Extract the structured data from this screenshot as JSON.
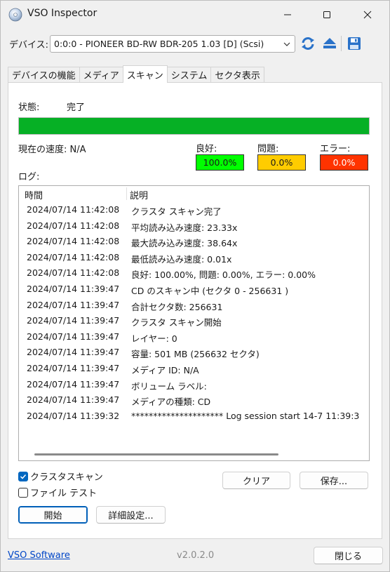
{
  "window": {
    "title": "VSO Inspector"
  },
  "device": {
    "label": "デバイス:",
    "selected": "0:0:0 - PIONEER BD-RW   BDR-205 1.03 [D] (Scsi)"
  },
  "tabs": [
    {
      "label": "デバイスの機能"
    },
    {
      "label": "メディア"
    },
    {
      "label": "スキャン"
    },
    {
      "label": "システム"
    },
    {
      "label": "セクタ表示"
    }
  ],
  "scan": {
    "status_label": "状態:",
    "status_value": "完了",
    "progress": 1.0,
    "speed_label": "現在の速度: N/A",
    "good_label": "良好:",
    "good_value": "100.0%",
    "problem_label": "問題:",
    "problem_value": "0.0%",
    "error_label": "エラー:",
    "error_value": "0.0%",
    "log_label": "ログ:",
    "log_header_time": "時間",
    "log_header_desc": "説明",
    "log": [
      {
        "time": "2024/07/14 11:42:08",
        "desc": "クラスタ スキャン完了"
      },
      {
        "time": "2024/07/14 11:42:08",
        "desc": "平均読み込み速度: 23.33x"
      },
      {
        "time": "2024/07/14 11:42:08",
        "desc": "最大読み込み速度: 38.64x"
      },
      {
        "time": "2024/07/14 11:42:08",
        "desc": "最低読み込み速度: 0.01x"
      },
      {
        "time": "2024/07/14 11:42:08",
        "desc": "良好: 100.00%, 問題: 0.00%, エラー: 0.00%"
      },
      {
        "time": "2024/07/14 11:39:47",
        "desc": "CD のスキャン中 (セクタ 0 - 256631 )"
      },
      {
        "time": "2024/07/14 11:39:47",
        "desc": "合計セクタ数: 256631"
      },
      {
        "time": "2024/07/14 11:39:47",
        "desc": "クラスタ スキャン開始"
      },
      {
        "time": "2024/07/14 11:39:47",
        "desc": "レイヤー: 0"
      },
      {
        "time": "2024/07/14 11:39:47",
        "desc": "容量: 501 MB (256632 セクタ)"
      },
      {
        "time": "2024/07/14 11:39:47",
        "desc": "メディア ID: N/A"
      },
      {
        "time": "2024/07/14 11:39:47",
        "desc": "ボリューム ラベル:"
      },
      {
        "time": "2024/07/14 11:39:47",
        "desc": "メディアの種類: CD"
      },
      {
        "time": "2024/07/14 11:39:32",
        "desc": "********************* Log session start 14-7 11:39:3"
      }
    ],
    "cluster_scan_label": "クラスタスキャン",
    "file_test_label": "ファイル テスト",
    "clear_label": "クリア",
    "save_label": "保存...",
    "start_label": "開始",
    "advanced_label": "詳細設定..."
  },
  "footer": {
    "link": "VSO Software",
    "version": "v2.0.2.0",
    "close_label": "閉じる"
  },
  "colors": {
    "progress": "#06b025",
    "good": "#00ff00",
    "problem": "#ffcc00",
    "error": "#ff3300"
  }
}
